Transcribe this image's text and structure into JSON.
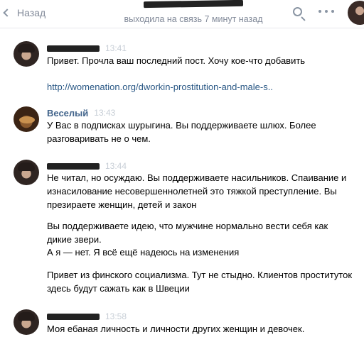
{
  "header": {
    "back_label": "Назад",
    "status": "выходила на связь 7 минут назад"
  },
  "messages": [
    {
      "time": "13:41",
      "lines": [
        "Привет. Прочла ваш последний пост. Хочу кое-что добавить"
      ],
      "link": "http://womenation.org/dworkin-prostitution-and-male-s.."
    },
    {
      "name": "Веселый",
      "time": "13:43",
      "text": "У Вас в подписках шурыгина. Вы поддерживаете шлюх. Более разговаривать не о чем."
    },
    {
      "time": "13:44",
      "p1": "Не читал, но осуждаю. Вы поддерживаете насильников. Спаивание и изнасилование несовершеннолетней это тяжкой преступление. Вы презираете женщин, детей и закон",
      "p2": "Вы поддерживаете идею, что мужчине нормально вести себя как дикие звери.",
      "p3": "А я — нет. Я всё ещё надеюсь на изменения",
      "p4": "Привет из финского социализма. Тут не стыдно. Клиентов проституток здесь будут сажать как в Швеции"
    },
    {
      "time": "13:58",
      "text": "Моя ебаная личность и личности других женщин и девочек."
    }
  ]
}
